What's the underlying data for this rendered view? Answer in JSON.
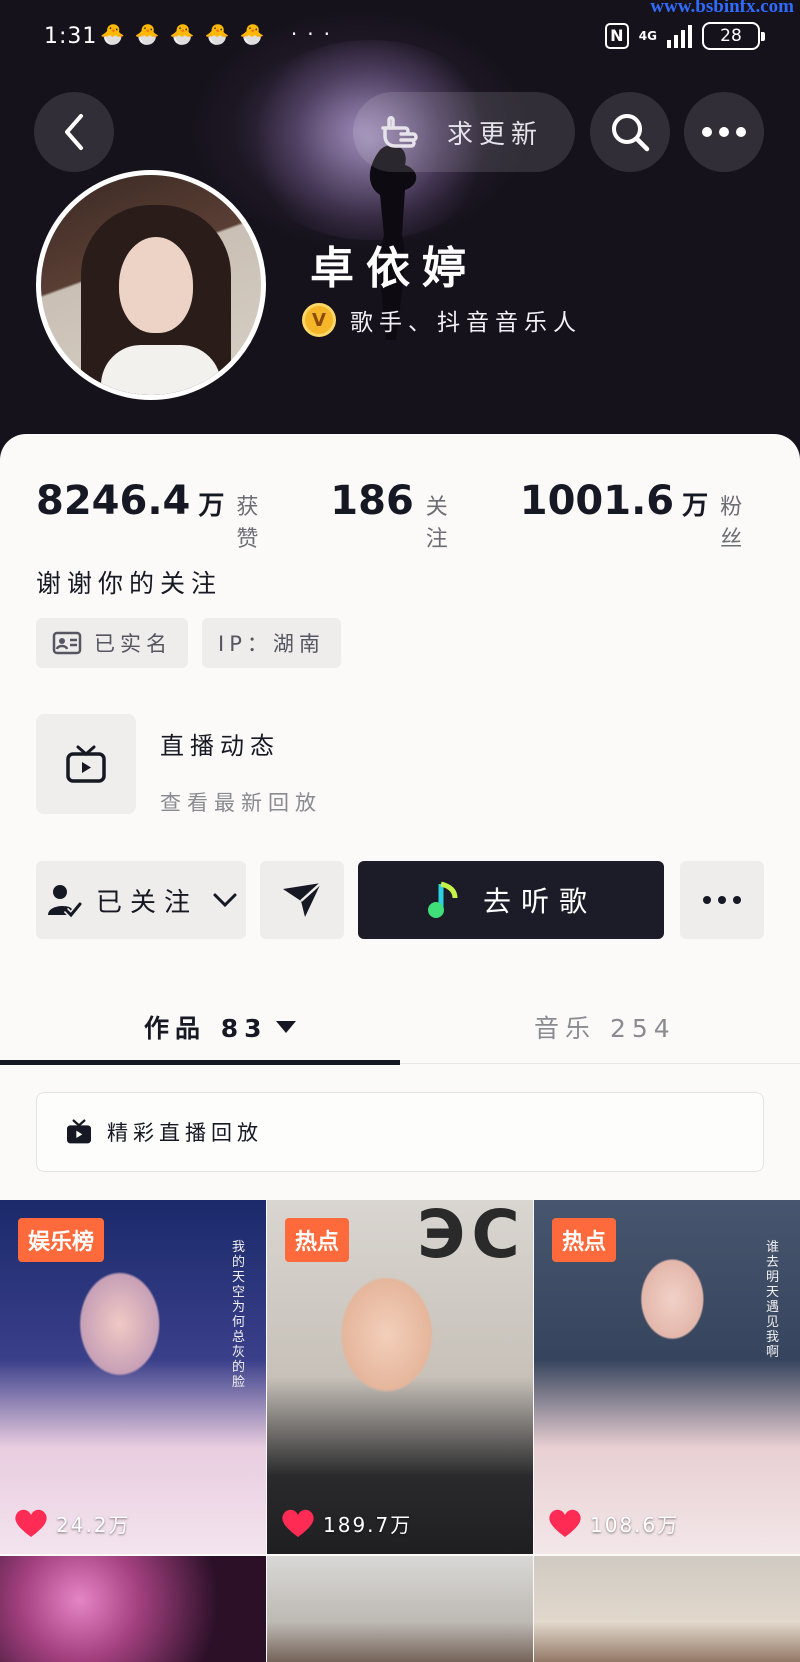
{
  "status_bar": {
    "time": "1:31",
    "emojis": "🐣🐣🐣🐣🐣",
    "overflow": "···",
    "nfc": "N",
    "network": "4G",
    "battery": "28"
  },
  "watermark": "www.bsbinfx.com",
  "header": {
    "follow_prompt": "求更新"
  },
  "profile": {
    "name": "卓依婷",
    "badge": "V",
    "verification": "歌手、抖音音乐人",
    "signature": "谢谢你的关注"
  },
  "stats": [
    {
      "value": "8246.4",
      "unit": "万",
      "label": "获赞"
    },
    {
      "value": "186",
      "unit": "",
      "label": "关注"
    },
    {
      "value": "1001.6",
      "unit": "万",
      "label": "粉丝"
    }
  ],
  "tags": {
    "realname": "已实名",
    "ip": "IP：湖南"
  },
  "live": {
    "title": "直播动态",
    "subtitle": "查看最新回放"
  },
  "actions": {
    "followed": "已关注",
    "listen": "去听歌"
  },
  "tabs": {
    "works": "作品 83",
    "music": "音乐 254"
  },
  "replay_banner": "精彩直播回放",
  "videos": [
    {
      "badge": "娱乐榜",
      "likes": "24.2万",
      "caption": "我的天空为何总灰的脸"
    },
    {
      "badge": "热点",
      "likes": "189.7万",
      "caption": ""
    },
    {
      "badge": "热点",
      "likes": "108.6万",
      "caption": "谁去明天 遇见我啊"
    }
  ],
  "colors": {
    "accent_badge": "#fe6a3c",
    "like_heart": "#fe2c55",
    "dark_button": "#1b1c27"
  }
}
